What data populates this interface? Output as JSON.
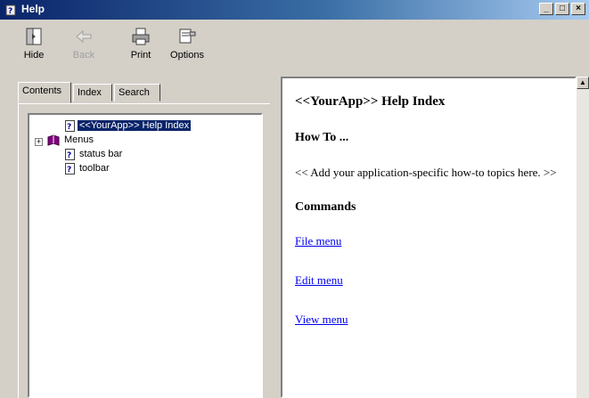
{
  "window": {
    "title": "Help",
    "controls": {
      "minimize": "_",
      "maximize": "□",
      "close": "×"
    }
  },
  "toolbar": {
    "hide": "Hide",
    "back": "Back",
    "print": "Print",
    "options": "Options"
  },
  "tabs": {
    "contents": "Contents",
    "index": "Index",
    "search": "Search"
  },
  "tree": {
    "items": [
      {
        "label": "<<YourApp>> Help Index",
        "icon": "help-page-icon",
        "selected": true
      },
      {
        "label": "Menus",
        "icon": "book-icon",
        "selected": false
      },
      {
        "label": "status bar",
        "icon": "help-page-icon",
        "selected": false
      },
      {
        "label": "toolbar",
        "icon": "help-page-icon",
        "selected": false
      }
    ]
  },
  "content": {
    "title": "<<YourApp>> Help Index",
    "howto_heading": "How To ...",
    "howto_text": "<< Add your application-specific how-to topics here. >>",
    "commands_heading": "Commands",
    "links": [
      "File menu",
      "Edit menu",
      "View menu"
    ]
  },
  "colors": {
    "selection": "#0a246a",
    "link": "#0000ee",
    "face": "#d4d0c8"
  }
}
